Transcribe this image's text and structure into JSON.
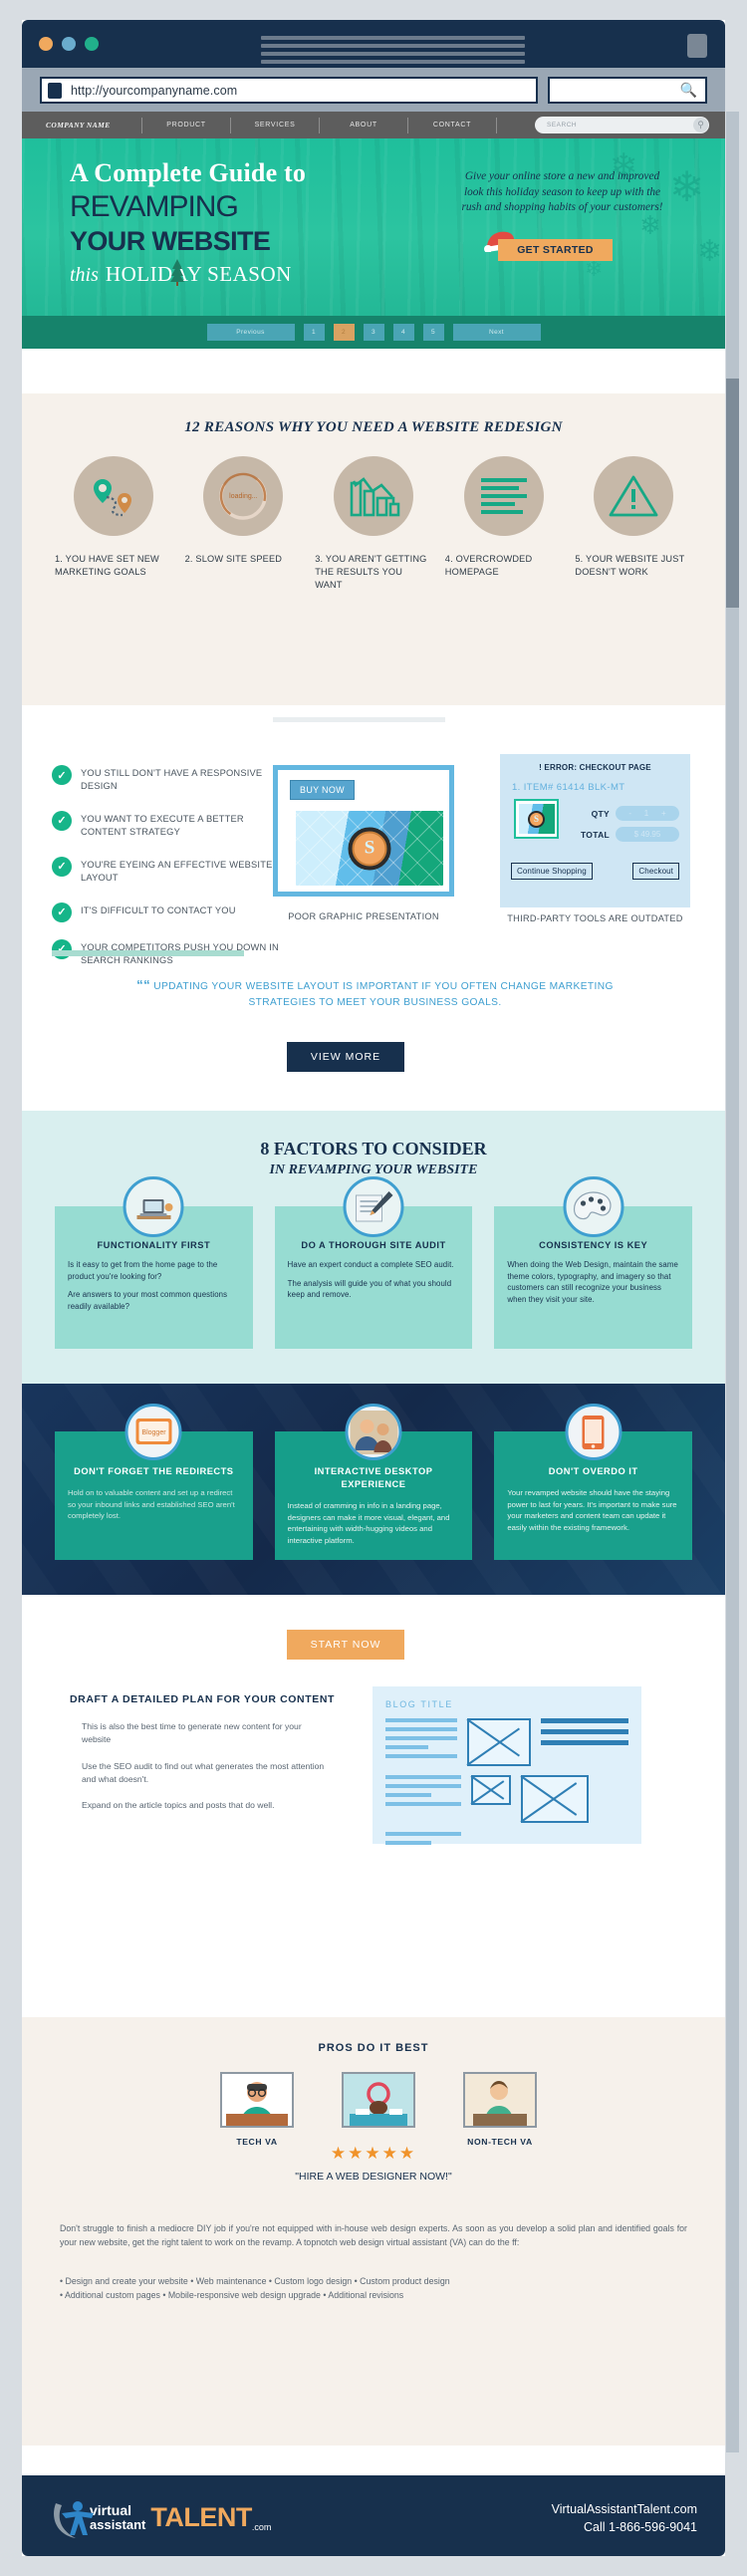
{
  "browser": {
    "url": "http://yourcompanyname.com",
    "search_placeholder": "",
    "search_icon": "search-icon"
  },
  "site_nav": {
    "brand": "COMPANY NAME",
    "items": [
      "PRODUCT",
      "SERVICES",
      "ABOUT",
      "CONTACT"
    ],
    "search_placeholder": "SEARCH"
  },
  "hero": {
    "line1": "A Complete Guide to",
    "line2": "REVAMPING",
    "line3": "YOUR WEBSITE",
    "line4_italic": "this",
    "line4_main": "HOLIDAY SEASON",
    "lede": "Give your online store a new and improved look this holiday season to keep up with the rush and shopping habits of your customers!",
    "cta": "GET STARTED"
  },
  "pagination": {
    "previous": "Previous",
    "pages": [
      "1",
      "2",
      "3",
      "4",
      "5"
    ],
    "active": "2",
    "next": "Next"
  },
  "reasons": {
    "heading": "12 REASONS WHY YOU NEED A WEBSITE REDESIGN",
    "items": [
      {
        "icon": "map-pin-route-icon",
        "label": "1. YOU HAVE SET NEW MARKETING GOALS"
      },
      {
        "icon": "loading-spinner-icon",
        "label": "2. SLOW SITE SPEED",
        "inner_text": "loading..."
      },
      {
        "icon": "declining-bar-chart-icon",
        "label": "3. YOU AREN'T GETTING THE RESULTS YOU WANT"
      },
      {
        "icon": "text-lines-icon",
        "label": "4. OVERCROWDED HOMEPAGE"
      },
      {
        "icon": "warning-triangle-icon",
        "label": "5. YOUR WEBSITE JUST DOESN'T WORK"
      }
    ]
  },
  "checks": {
    "items": [
      "YOU STILL DON'T HAVE A RESPONSIVE DESIGN",
      "YOU WANT TO EXECUTE A BETTER CONTENT STRATEGY",
      "YOU'RE EYEING AN EFFECTIVE WEBSITE LAYOUT",
      "IT'S DIFFICULT TO CONTACT YOU",
      "YOUR COMPETITORS PUSH YOU DOWN IN SEARCH RANKINGS"
    ],
    "mock": {
      "buy_now": "BUY NOW",
      "coin_symbol": "S",
      "caption": "POOR GRAPHIC PRESENTATION"
    },
    "checkout": {
      "error": "! ERROR: CHECKOUT PAGE",
      "item": "1. ITEM# 61414 BLK-MT",
      "qty_label": "QTY",
      "qty_minus": "-",
      "qty_value": "1",
      "qty_plus": "+",
      "total_label": "TOTAL",
      "total_value": "$ 49.95",
      "continue_btn": "Continue Shopping",
      "checkout_btn": "Checkout",
      "caption": "THIRD-PARTY TOOLS ARE OUTDATED"
    },
    "quote": "UPDATING YOUR WEBSITE LAYOUT IS IMPORTANT IF YOU OFTEN CHANGE MARKETING STRATEGIES TO MEET YOUR BUSINESS GOALS.",
    "view_more": "VIEW MORE"
  },
  "factors": {
    "heading1": "8 FACTORS TO CONSIDER",
    "heading2": "IN REVAMPING YOUR WEBSITE",
    "cards": [
      {
        "icon": "laptop-desk-icon",
        "title": "FUNCTIONALITY FIRST",
        "body": [
          "Is it easy to get from the home page to the product you're looking for?",
          "Are answers to your most common questions readily available?"
        ]
      },
      {
        "icon": "hand-writing-pen-icon",
        "title": "DO A THOROUGH SITE AUDIT",
        "body": [
          "Have an expert conduct a complete SEO audit.",
          "The analysis will guide you of what you should keep and remove."
        ]
      },
      {
        "icon": "color-palette-icon",
        "title": "CONSISTENCY IS KEY",
        "body": [
          "When doing the Web Design, maintain the same theme colors, typography, and imagery so that customers can still recognize your business when they visit your site."
        ]
      }
    ]
  },
  "dark_cards": [
    {
      "icon": "blogger-redirect-icon",
      "title": "DON'T FORGET THE REDIRECTS",
      "body": "Hold on to valuable content and set up a redirect so your inbound links and established SEO aren't completely lost."
    },
    {
      "icon": "people-photo-icon",
      "title": "INTERACTIVE DESKTOP EXPERIENCE",
      "body": "Instead of cramming in info in a landing page, designers can make it more visual, elegant, and entertaining with width-hugging videos and interactive platform."
    },
    {
      "icon": "tablet-device-icon",
      "title": "DON'T OVERDO IT",
      "body": "Your revamped website should have the staying power to last for years. It's important to make sure your marketers and content team can update it easily within the existing framework."
    }
  ],
  "plan": {
    "start_now": "START NOW",
    "title": "DRAFT A DETAILED PLAN FOR YOUR CONTENT",
    "paragraphs": [
      "This is also the best time to generate new content for your website",
      "Use the SEO audit to find out what generates the most attention and what doesn't.",
      "Expand on the article topics and posts that do well."
    ],
    "wireframe_title": "BLOG TITLE"
  },
  "pros": {
    "heading": "PROS DO IT BEST",
    "cells": [
      {
        "thumb": "tech-va-photo",
        "label": "TECH VA"
      },
      {
        "thumb": "web-designer-photo",
        "label": ""
      },
      {
        "thumb": "non-tech-va-photo",
        "label": "NON-TECH VA"
      }
    ],
    "stars": "★★★★★",
    "stars_count": 5,
    "hire_text": "\"HIRE A WEB DESIGNER NOW!\"",
    "body": "Don't struggle to finish a mediocre DIY job if you're not equipped with in-house web design experts. As soon as you develop a solid plan and identified goals for your new website, get the right talent to work on the revamp. A topnotch web design virtual assistant (VA) can do the ff:",
    "list": [
      "• Design and create your website • Web maintenance • Custom logo design • Custom product design",
      "• Additional custom pages • Mobile-responsive web design upgrade • Additional revisions"
    ]
  },
  "footer": {
    "logo_line1": "virtual",
    "logo_line2": "assistant",
    "logo_talent": "TALENT",
    "logo_com": ".com",
    "site": "VirtualAssistantTalent.com",
    "phone": "Call 1-866-596-9041"
  },
  "colors": {
    "teal": "#1fbf9c",
    "navy": "#17304d",
    "orange": "#f0a95e",
    "blue": "#3f9fd0",
    "cream": "#f6f1eb"
  }
}
